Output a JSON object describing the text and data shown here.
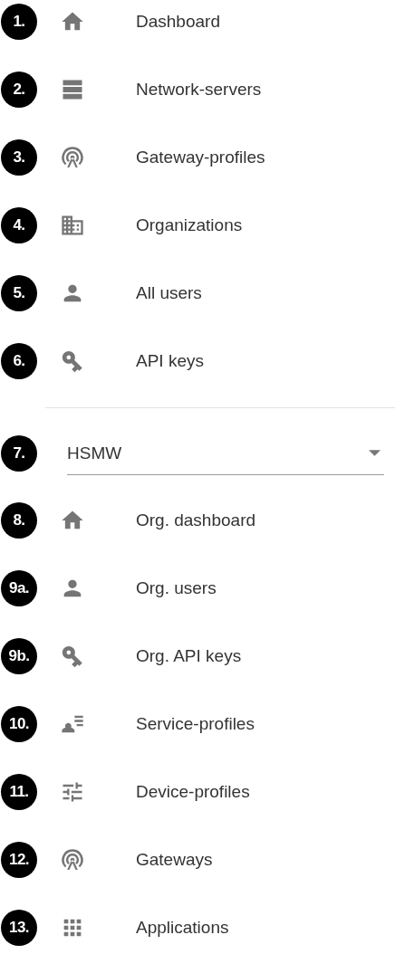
{
  "admin_items": [
    {
      "badge": "1.",
      "kind": "home",
      "label": "Dashboard"
    },
    {
      "badge": "2.",
      "kind": "servers",
      "label": "Network-servers"
    },
    {
      "badge": "3.",
      "kind": "antenna",
      "label": "Gateway-profiles"
    },
    {
      "badge": "4.",
      "kind": "building",
      "label": "Organizations"
    },
    {
      "badge": "5.",
      "kind": "person",
      "label": "All users"
    },
    {
      "badge": "6.",
      "kind": "key",
      "label": "API keys"
    }
  ],
  "organization_select": {
    "badge": "7.",
    "value": "HSMW"
  },
  "org_items": [
    {
      "badge": "8.",
      "kind": "home",
      "label": "Org. dashboard"
    },
    {
      "badge": "9a.",
      "kind": "person",
      "label": "Org. users"
    },
    {
      "badge": "9b.",
      "kind": "key",
      "label": "Org. API keys"
    },
    {
      "badge": "10.",
      "kind": "person-list",
      "label": "Service-profiles"
    },
    {
      "badge": "11.",
      "kind": "sliders",
      "label": "Device-profiles"
    },
    {
      "badge": "12.",
      "kind": "antenna",
      "label": "Gateways"
    },
    {
      "badge": "13.",
      "kind": "grid",
      "label": "Applications"
    }
  ]
}
